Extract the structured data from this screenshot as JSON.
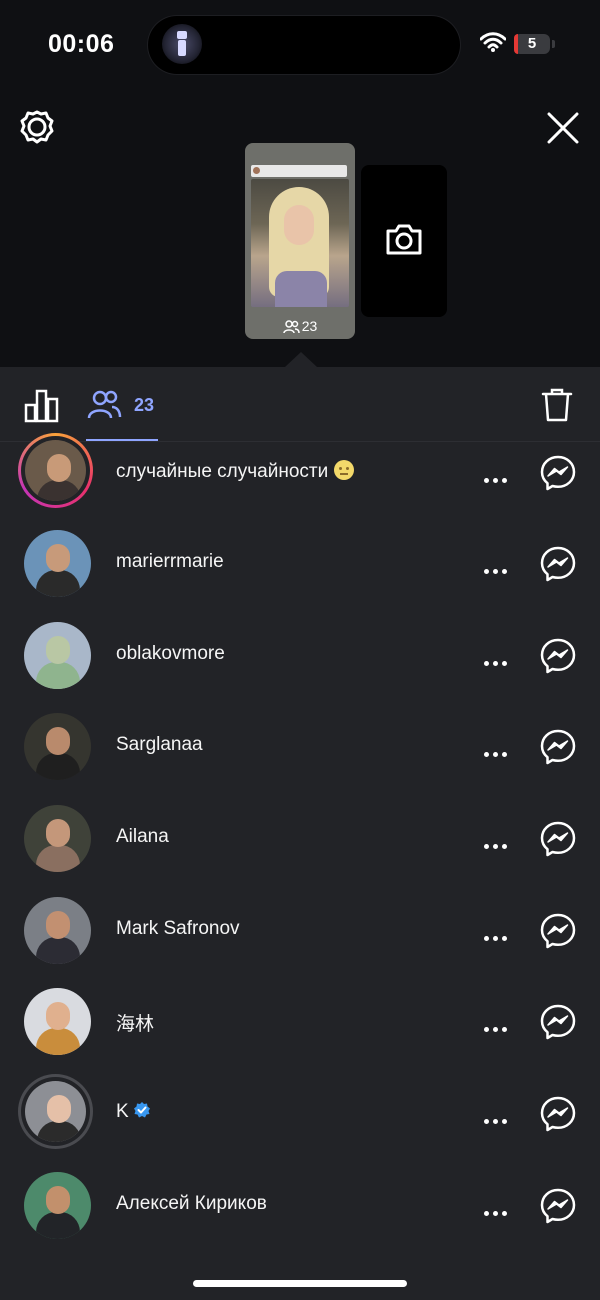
{
  "status_bar": {
    "time": "00:06",
    "battery_level": "5"
  },
  "story": {
    "viewer_count": "23"
  },
  "tabs": {
    "viewers_count": "23"
  },
  "viewers": [
    {
      "name": "случайные случайности",
      "has_emoji": true,
      "emoji": "slightly-frowning-face",
      "ring": "story-gradient",
      "avatar_bg": "#6a5a4a",
      "cloth": "#3a3230",
      "skin": "#c89a78"
    },
    {
      "name": "marierrmarie",
      "avatar_bg": "#6b93b8",
      "cloth": "#2a2a2a",
      "skin": "#c79a7a"
    },
    {
      "name": "oblakovmore",
      "avatar_bg": "#a9b7c9",
      "cloth": "#8fb48e",
      "skin": "#b9c7a4"
    },
    {
      "name": "Sarglanaa",
      "avatar_bg": "#35352f",
      "cloth": "#1f1f1f",
      "skin": "#b98a6c"
    },
    {
      "name": "Ailana",
      "avatar_bg": "#3f4239",
      "cloth": "#8a6f60",
      "skin": "#c4977a"
    },
    {
      "name": "Mark Safronov",
      "avatar_bg": "#7b7f86",
      "cloth": "#2c2c34",
      "skin": "#c29071"
    },
    {
      "name": "海林",
      "avatar_bg": "#d9dbe0",
      "cloth": "#c98d3c",
      "skin": "#e0b08e"
    },
    {
      "name": "K",
      "verified": true,
      "ring": "seen-gray",
      "avatar_bg": "#8d8f95",
      "cloth": "#2b2b2b",
      "skin": "#e5c0a8"
    },
    {
      "name": "Алексей Кириков",
      "avatar_bg": "#4d8a6b",
      "cloth": "#222428",
      "skin": "#c2906c"
    }
  ],
  "colors": {
    "accent": "#8fa5ff",
    "sheet_bg": "#222327",
    "top_bg": "#0f1013",
    "verified": "#3897f0"
  }
}
